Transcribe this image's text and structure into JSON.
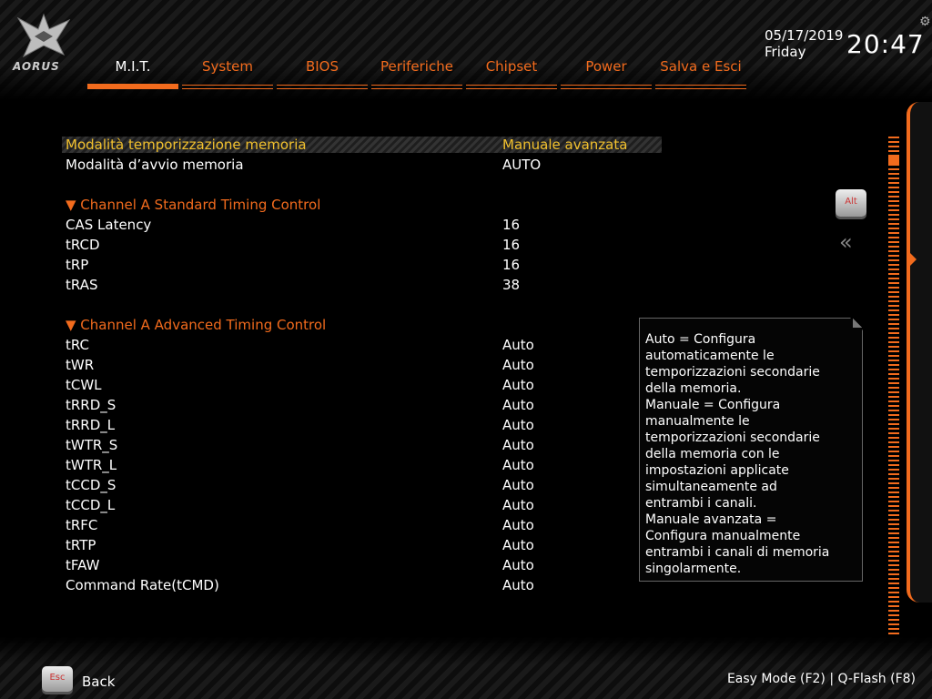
{
  "brand": {
    "logo_text": "AORUS"
  },
  "tabs": [
    "M.I.T.",
    "System",
    "BIOS",
    "Periferiche",
    "Chipset",
    "Power",
    "Salva e Esci"
  ],
  "active_tab": "M.I.T.",
  "header": {
    "date": "05/17/2019",
    "day": "Friday",
    "time": "20:47"
  },
  "settings": {
    "mode": {
      "label": "Modalità temporizzazione memoria",
      "value": "Manuale avanzata"
    },
    "boot": {
      "label": "Modalità d’avvio memoria",
      "value": "AUTO"
    },
    "std_header": "▼ Channel A Standard Timing Control",
    "std": [
      {
        "label": "CAS Latency",
        "value": "16"
      },
      {
        "label": "tRCD",
        "value": "16"
      },
      {
        "label": "tRP",
        "value": "16"
      },
      {
        "label": "tRAS",
        "value": "38"
      }
    ],
    "adv_header": "▼ Channel A Advanced Timing Control",
    "adv": [
      {
        "label": "tRC",
        "value": "Auto"
      },
      {
        "label": "tWR",
        "value": "Auto"
      },
      {
        "label": "tCWL",
        "value": "Auto"
      },
      {
        "label": "tRRD_S",
        "value": "Auto"
      },
      {
        "label": "tRRD_L",
        "value": "Auto"
      },
      {
        "label": "tWTR_S",
        "value": "Auto"
      },
      {
        "label": "tWTR_L",
        "value": "Auto"
      },
      {
        "label": "tCCD_S",
        "value": "Auto"
      },
      {
        "label": "tCCD_L",
        "value": "Auto"
      },
      {
        "label": "tRFC",
        "value": "Auto"
      },
      {
        "label": "tRTP",
        "value": "Auto"
      },
      {
        "label": "tFAW",
        "value": "Auto"
      },
      {
        "label": "Command Rate(tCMD)",
        "value": "Auto"
      }
    ]
  },
  "help_text": "Auto = Configura\nautomaticamente le\ntemporizzazioni secondarie\ndella memoria.\nManuale = Configura\nmanualmente le\ntemporizzazioni secondarie\ndella memoria con le\nimpostazioni applicate\nsimultaneamente ad\nentrambi i canali.\nManuale avanzata =\nConfigura manualmente\nentrambi i canali di memoria\nsingolarmente.",
  "keys": {
    "alt": "Alt",
    "esc": "Esc"
  },
  "footer": {
    "back": "Back",
    "easy_mode": "Easy Mode (F2)",
    "separator": "|",
    "qflash": "Q-Flash (F8)"
  },
  "colors": {
    "accent": "#f26b1d",
    "selected_text": "#f2c12e"
  }
}
